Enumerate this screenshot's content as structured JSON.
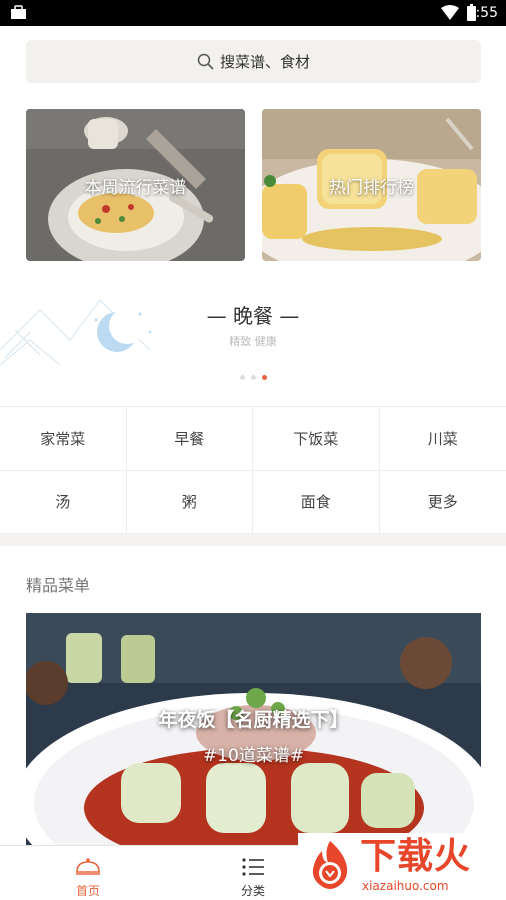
{
  "status_bar": {
    "time": "2:55",
    "icons": [
      "bag-icon",
      "wifi-icon",
      "battery-icon"
    ]
  },
  "search": {
    "label": "搜菜谱、食材",
    "icon": "search-icon"
  },
  "features": [
    {
      "label": "本周流行菜谱"
    },
    {
      "label": "热门排行榜"
    }
  ],
  "meal_banner": {
    "title": "— 晚餐 —",
    "subtitle": "精致 健康",
    "page_dots": 3,
    "active_dot": 3,
    "icon": "moon-icon"
  },
  "categories": [
    "家常菜",
    "早餐",
    "下饭菜",
    "川菜",
    "汤",
    "粥",
    "面食",
    "更多"
  ],
  "section": {
    "title": "精品菜单"
  },
  "menu_card": {
    "title": "年夜饭【名厨精选下】",
    "subtitle": "#10道菜谱#"
  },
  "tabs": [
    {
      "label": "首页",
      "icon": "chef-hat-icon",
      "active": true
    },
    {
      "label": "分类",
      "icon": "list-icon",
      "active": false
    }
  ],
  "watermark": {
    "brand": "下载火",
    "url": "xiazaihuo.com"
  },
  "colors": {
    "accent": "#e8663d",
    "watermark": "#e8462b",
    "search_bg": "#f3f1ee"
  }
}
